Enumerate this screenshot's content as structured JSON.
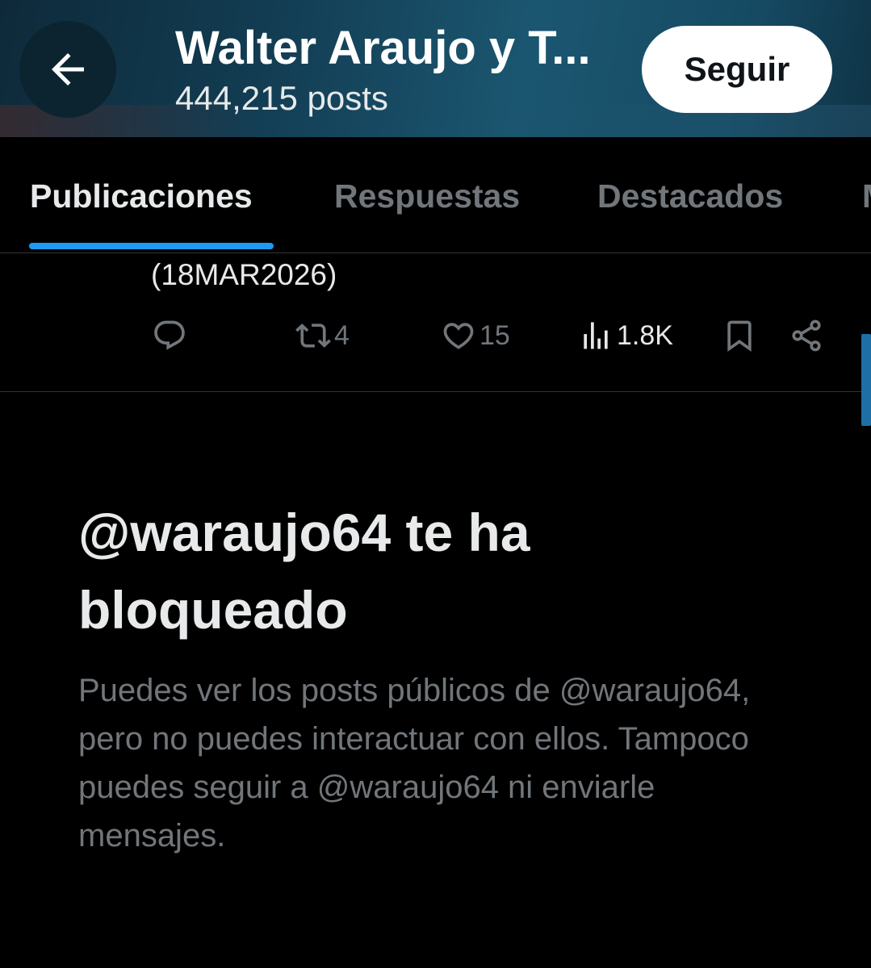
{
  "header": {
    "back_icon": "arrow-left-icon",
    "title": "Walter Araujo y T...",
    "post_count": "444,215 posts",
    "follow_label": "Seguir"
  },
  "tabs": [
    {
      "label": "Publicaciones",
      "active": true
    },
    {
      "label": "Respuestas",
      "active": false
    },
    {
      "label": "Destacados",
      "active": false
    }
  ],
  "tweet": {
    "text_fragment": "(18MAR2026)",
    "actions": {
      "reply_icon": "reply-icon",
      "repost_icon": "repost-icon",
      "repost_count": "4",
      "like_icon": "heart-icon",
      "like_count": "15",
      "views_icon": "views-icon",
      "views_count": "1.8K",
      "bookmark_icon": "bookmark-icon",
      "share_icon": "share-icon"
    }
  },
  "blocked": {
    "title": "@waraujo64 te ha bloqueado",
    "description": "Puedes ver los posts públicos de @waraujo64, pero no puedes interactuar con ellos. Tampoco puedes seguir a @waraujo64 ni enviarle mensajes."
  },
  "colors": {
    "accent": "#1d9bf0",
    "muted": "#71767b",
    "text": "#e7e9ea",
    "background": "#000000"
  }
}
